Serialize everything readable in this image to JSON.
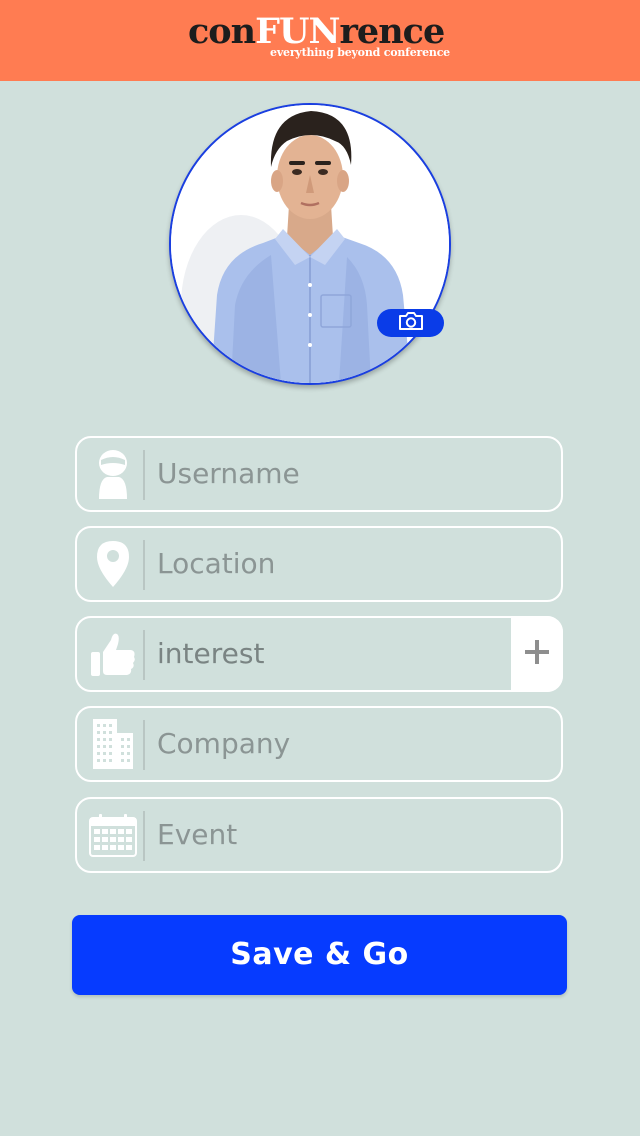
{
  "header": {
    "logo": {
      "part1": "con",
      "part2": "FUN",
      "part3": "rence",
      "tagline": "everything beyond conference"
    },
    "background_color": "#ff7c52"
  },
  "profile": {
    "camera_icon": "camera-icon"
  },
  "form": {
    "fields": [
      {
        "icon": "user-mask-icon",
        "placeholder": "Username"
      },
      {
        "icon": "map-pin-icon",
        "placeholder": "Location"
      },
      {
        "icon": "thumbs-up-icon",
        "placeholder": "interest",
        "action_icon": "plus-icon"
      },
      {
        "icon": "buildings-icon",
        "placeholder": "Company"
      },
      {
        "icon": "calendar-icon",
        "placeholder": "Event"
      }
    ]
  },
  "actions": {
    "save_label": "Save & Go",
    "save_color": "#063bff"
  },
  "colors": {
    "background": "#d0e0dc",
    "accent_blue": "#0a3ce8",
    "placeholder_text": "#8b9594"
  }
}
